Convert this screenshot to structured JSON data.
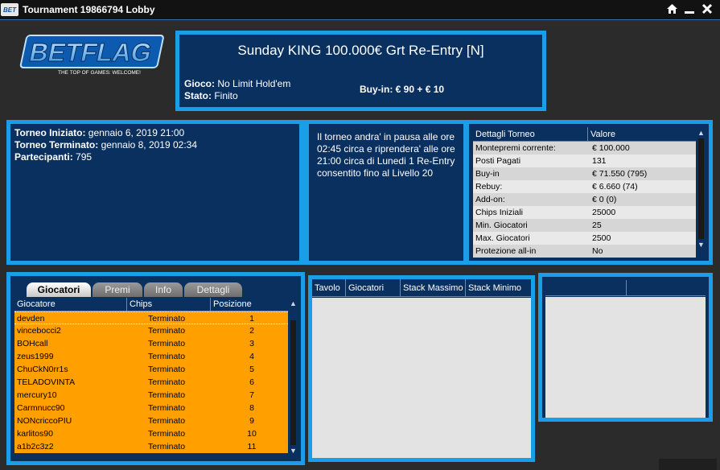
{
  "window": {
    "title": "Tournament 19866794 Lobby",
    "icon_text": "BET",
    "controls": [
      "home-icon",
      "minimize-icon",
      "close-icon"
    ]
  },
  "logo": {
    "brand": "BETFLAG",
    "tagline": "THE TOP OF GAMES: WELCOME!"
  },
  "header": {
    "tournament_name": "Sunday KING 100.000€ Grt Re-Entry    [N]",
    "game_label": "Gioco:",
    "game_value": "No Limit Hold'em",
    "state_label": "Stato:",
    "state_value": "Finito",
    "buyin_label": "Buy-in:",
    "buyin_value": "€ 90 + € 10"
  },
  "info": {
    "started_label": "Torneo Iniziato:",
    "started_value": "gennaio 6, 2019 21:00",
    "ended_label": "Torneo Terminato:",
    "ended_value": "gennaio 8, 2019 02:34",
    "participants_label": "Partecipanti:",
    "participants_value": "795",
    "note": "Il torneo andra' in pausa alle ore 02:45 circa e riprendera' alle ore 21:00 circa di Lunedi 1 Re-Entry consentito fino al Livello 20"
  },
  "details": {
    "headers": [
      "Dettagli Torneo",
      "Valore"
    ],
    "rows": [
      [
        "Montepremi corrente:",
        "€ 100.000"
      ],
      [
        "Posti Pagati",
        "131"
      ],
      [
        "Buy-in",
        "€ 71.550 (795)"
      ],
      [
        "Rebuy:",
        "€ 6.660 (74)"
      ],
      [
        "Add-on:",
        "€ 0 (0)"
      ],
      [
        "Chips Iniziali",
        "25000"
      ],
      [
        "Min. Giocatori",
        "25"
      ],
      [
        "Max. Giocatori",
        "2500"
      ],
      [
        "Protezione all-in",
        "No"
      ]
    ]
  },
  "tabs": [
    "Giocatori",
    "Premi",
    "Info",
    "Dettagli"
  ],
  "players": {
    "headers": [
      "Giocatore",
      "Chips",
      "Posizione"
    ],
    "rows": [
      [
        "devden",
        "Terminato",
        "1"
      ],
      [
        "vincebocci2",
        "Terminato",
        "2"
      ],
      [
        "BOHcall",
        "Terminato",
        "3"
      ],
      [
        "zeus1999",
        "Terminato",
        "4"
      ],
      [
        "ChuCkN0rr1s",
        "Terminato",
        "5"
      ],
      [
        "TELADOVINTA",
        "Terminato",
        "6"
      ],
      [
        "mercury10",
        "Terminato",
        "7"
      ],
      [
        "Carmnucc90",
        "Terminato",
        "8"
      ],
      [
        "NONcriccoPIU",
        "Terminato",
        "9"
      ],
      [
        "karlitos90",
        "Terminato",
        "10"
      ],
      [
        "a1b2c3z2",
        "Terminato",
        "11"
      ]
    ]
  },
  "tables": {
    "headers": [
      "Tavolo",
      "Giocatori",
      "Stack Massimo",
      "Stack Minimo"
    ]
  }
}
